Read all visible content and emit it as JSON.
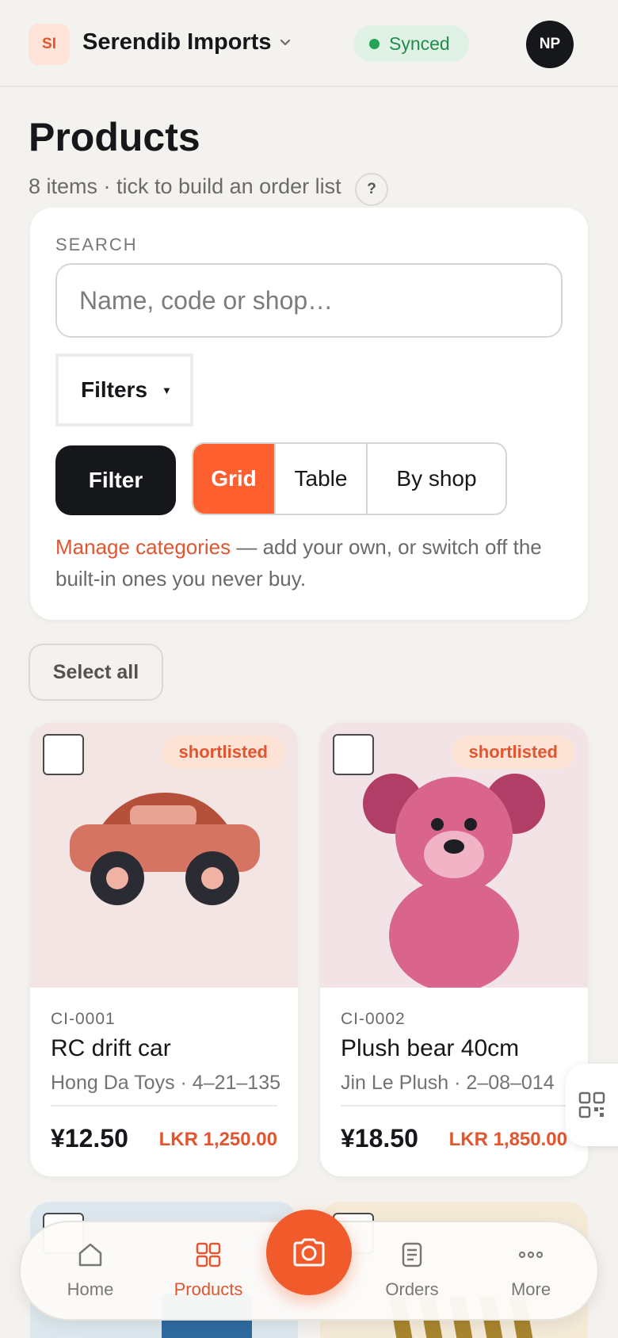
{
  "header": {
    "org_initials": "SI",
    "org_name": "Serendib Imports",
    "sync_status": "Synced",
    "user_initials": "NP"
  },
  "page": {
    "title": "Products",
    "subtitle": "8 items · tick to build an order list",
    "help_label": "?"
  },
  "search": {
    "label": "SEARCH",
    "placeholder": "Name, code or shop…",
    "value": "",
    "filters_label": "Filters",
    "filter_button": "Filter",
    "views": [
      "Grid",
      "Table",
      "By shop"
    ],
    "active_view": "Grid",
    "manage_link": "Manage categories",
    "manage_note": " — add your own, or switch off the built-in ones you never buy."
  },
  "select_all_label": "Select all",
  "products": [
    {
      "code": "CI-0001",
      "name": "RC drift car",
      "supplier": "Hong Da Toys · 4–21–135",
      "price": "¥12.50",
      "local_price": "LKR 1,250.00",
      "badge": "shortlisted",
      "image": "toy-car-icon",
      "checked": false
    },
    {
      "code": "CI-0002",
      "name": "Plush bear 40cm",
      "supplier": "Jin Le Plush · 2–08–014",
      "price": "¥18.50",
      "local_price": "LKR 1,850.00",
      "badge": "shortlisted",
      "image": "plush-bear-icon",
      "checked": false
    }
  ],
  "nav": {
    "items": [
      {
        "label": "Home",
        "icon": "home-icon"
      },
      {
        "label": "Products",
        "icon": "grid-icon"
      },
      {
        "label": "Orders",
        "icon": "receipt-icon"
      },
      {
        "label": "More",
        "icon": "more-dots-icon"
      }
    ],
    "active": "Products",
    "camera_icon": "camera-icon"
  },
  "colors": {
    "accent": "#fe6030",
    "accent_text": "#e2552e",
    "dark": "#16171b",
    "background": "#f4f2ee",
    "synced_green": "#22a355"
  }
}
